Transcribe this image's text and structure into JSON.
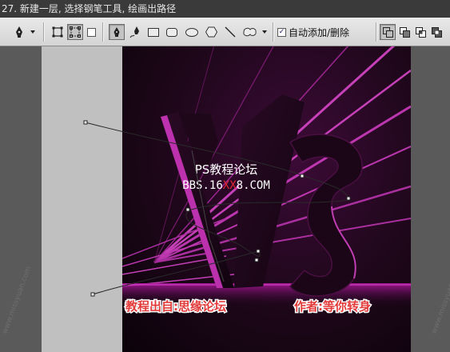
{
  "title_bar": {
    "text": "27. 新建一层, 选择钢笔工具, 绘画出路径"
  },
  "options_bar": {
    "pen_tool_icon": "pen-icon",
    "dropdown_icon": "chevron-down-icon",
    "shape_layers_icon": "shape-layers-icon",
    "paths_icon": "paths-icon",
    "fill_pixels_icon": "fill-pixels-icon",
    "shapes": [
      "pen-icon",
      "freeform-pen-icon",
      "rectangle-icon",
      "rounded-rectangle-icon",
      "ellipse-icon",
      "polygon-icon",
      "line-icon",
      "custom-shape-icon"
    ],
    "auto_add_delete": {
      "checked": true,
      "label": "自动添加/删除"
    },
    "path_modes": [
      "add-to-path-icon",
      "subtract-from-path-icon",
      "intersect-path-icon",
      "exclude-overlap-icon"
    ]
  },
  "artwork": {
    "forum_name": "PS教程论坛",
    "url_prefix": "BBS.16",
    "url_highlight": "XX",
    "url_suffix": "8.COM",
    "caption_left": "教程出自:思缘论坛",
    "caption_right": "作者:等你转身",
    "watermark": "www.missyuan.com",
    "colors": {
      "accent_magenta": "#d640c8",
      "background_dark": "#1d0719",
      "caption_red": "#e33a3a",
      "url_highlight_red": "#e0262f"
    }
  }
}
